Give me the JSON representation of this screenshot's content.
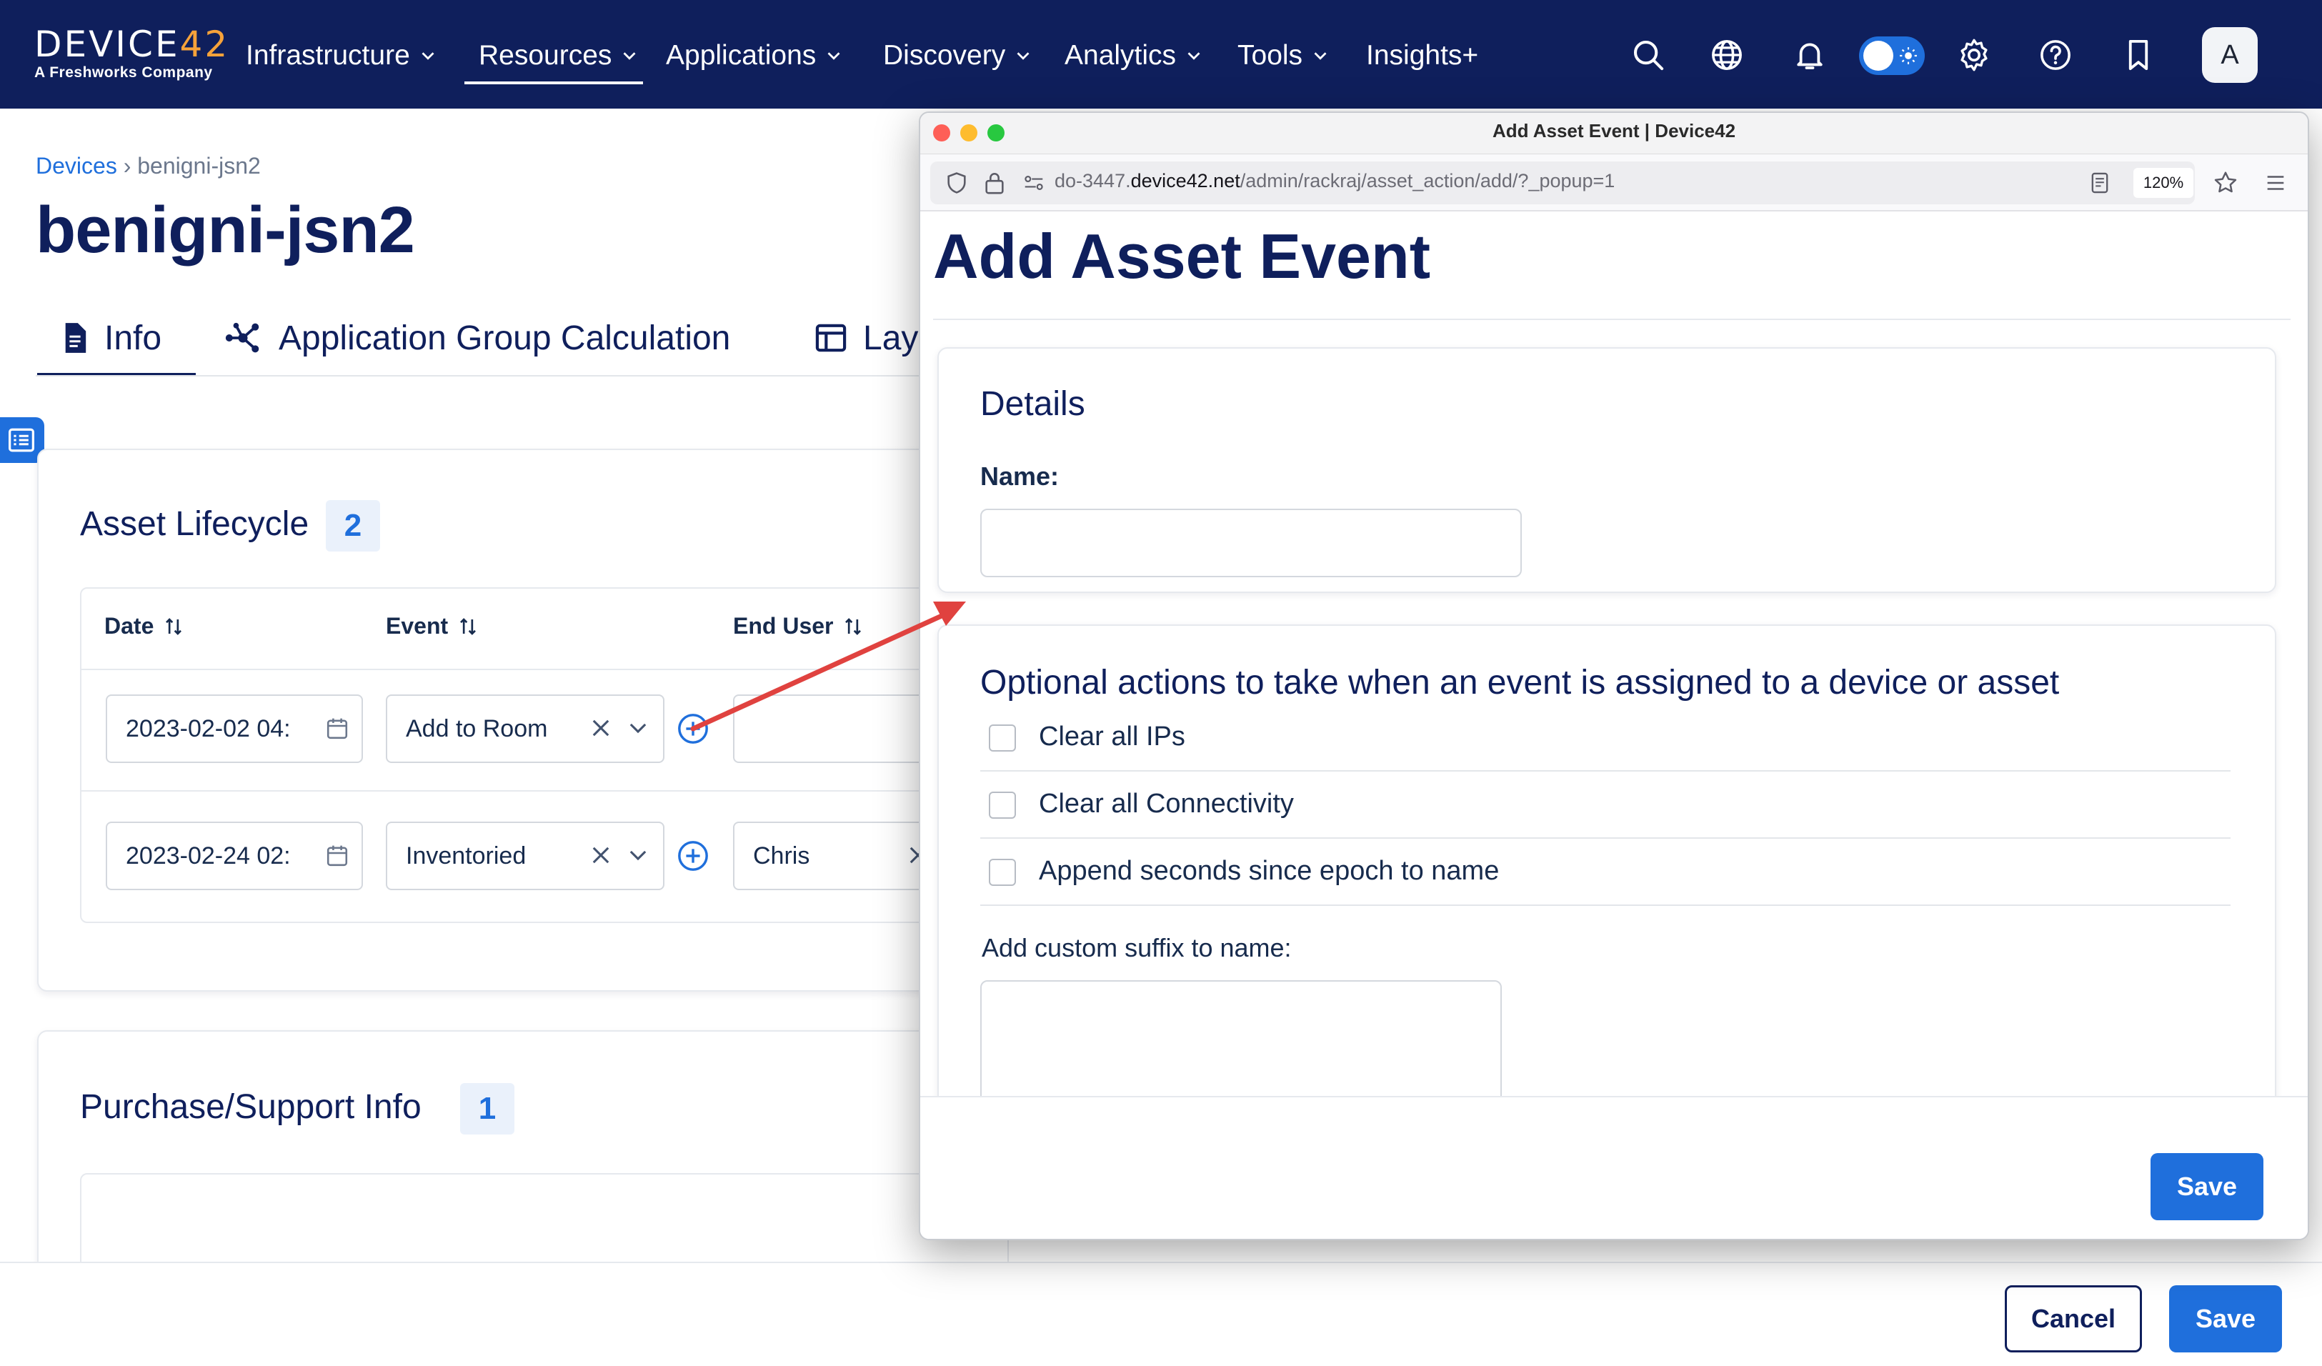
{
  "brand": {
    "logo_word": "DEVICE",
    "logo_num": "42",
    "logo_sub": "A Freshworks Company",
    "nav_color": "#0f1f5c",
    "accent_color": "#1f6fdc",
    "logo_accent": "#f6a23a"
  },
  "nav": {
    "items": [
      {
        "label": "Infrastructure",
        "has_menu": true
      },
      {
        "label": "Resources",
        "has_menu": true,
        "active": true
      },
      {
        "label": "Applications",
        "has_menu": true
      },
      {
        "label": "Discovery",
        "has_menu": true
      },
      {
        "label": "Analytics",
        "has_menu": true
      },
      {
        "label": "Tools",
        "has_menu": true
      },
      {
        "label": "Insights+",
        "has_menu": false
      }
    ],
    "icons": [
      "search-icon",
      "globe-icon",
      "bell-icon",
      "theme-toggle",
      "gear-icon",
      "help-icon",
      "bookmark-icon"
    ],
    "avatar_initial": "A"
  },
  "page": {
    "breadcrumb_link": "Devices",
    "breadcrumb_sep": "›",
    "breadcrumb_current": "benigni-jsn2",
    "title": "benigni-jsn2",
    "tabs": [
      {
        "label": "Info",
        "icon": "document-icon",
        "active": true
      },
      {
        "label": "Application Group Calculation",
        "icon": "network-icon"
      },
      {
        "label": "Lay",
        "icon": "layout-icon"
      }
    ]
  },
  "lifecycle": {
    "title": "Asset Lifecycle",
    "count": "2",
    "columns": [
      "Date",
      "Event",
      "End User"
    ],
    "rows": [
      {
        "date": "2023-02-02 04:",
        "event": "Add to Room",
        "end_user": ""
      },
      {
        "date": "2023-02-24 02:",
        "event": "Inventoried",
        "end_user": "Chris"
      }
    ]
  },
  "purchase": {
    "title": "Purchase/Support Info",
    "count": "1"
  },
  "footer": {
    "cancel_label": "Cancel",
    "save_label": "Save"
  },
  "popup": {
    "window_title": "Add Asset Event | Device42",
    "url_prefix": "do-3447.",
    "url_host": "device42.net",
    "url_path": "/admin/rackraj/asset_action/add/?_popup=1",
    "zoom": "120%",
    "heading": "Add Asset Event",
    "details_title": "Details",
    "name_label": "Name:",
    "name_value": "",
    "optional_title": "Optional actions to take when an event is assigned to a device or asset",
    "options": [
      {
        "label": "Clear all IPs",
        "checked": false
      },
      {
        "label": "Clear all Connectivity",
        "checked": false
      },
      {
        "label": "Append seconds since epoch to name",
        "checked": false
      }
    ],
    "suffix_label": "Add custom suffix to name:",
    "suffix_value": "",
    "save_label": "Save"
  }
}
